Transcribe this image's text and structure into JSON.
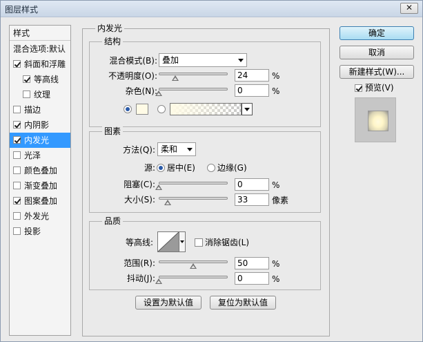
{
  "window": {
    "title": "图层样式",
    "close_glyph": "✕"
  },
  "style_list": {
    "header": "样式",
    "items": [
      {
        "label": "混合选项:默认",
        "checkbox": false,
        "indent": 0,
        "checked": false
      },
      {
        "label": "斜面和浮雕",
        "checkbox": true,
        "indent": 0,
        "checked": true
      },
      {
        "label": "等高线",
        "checkbox": true,
        "indent": 1,
        "checked": true
      },
      {
        "label": "纹理",
        "checkbox": true,
        "indent": 1,
        "checked": false
      },
      {
        "label": "描边",
        "checkbox": true,
        "indent": 0,
        "checked": false
      },
      {
        "label": "内阴影",
        "checkbox": true,
        "indent": 0,
        "checked": true
      },
      {
        "label": "内发光",
        "checkbox": true,
        "indent": 0,
        "checked": true,
        "selected": true
      },
      {
        "label": "光泽",
        "checkbox": true,
        "indent": 0,
        "checked": false
      },
      {
        "label": "颜色叠加",
        "checkbox": true,
        "indent": 0,
        "checked": false
      },
      {
        "label": "渐变叠加",
        "checkbox": true,
        "indent": 0,
        "checked": false
      },
      {
        "label": "图案叠加",
        "checkbox": true,
        "indent": 0,
        "checked": true
      },
      {
        "label": "外发光",
        "checkbox": true,
        "indent": 0,
        "checked": false
      },
      {
        "label": "投影",
        "checkbox": true,
        "indent": 0,
        "checked": false
      }
    ]
  },
  "panel": {
    "title": "内发光",
    "structure": {
      "title": "结构",
      "blend_mode_label": "混合模式(B):",
      "blend_mode_value": "叠加",
      "opacity_label": "不透明度(O):",
      "opacity_value": "24",
      "opacity_unit": "%",
      "opacity_fraction": 0.24,
      "noise_label": "杂色(N):",
      "noise_value": "0",
      "noise_unit": "%",
      "noise_fraction": 0.0,
      "color_mode": "solid",
      "glow_color": "#fffbe6"
    },
    "elements": {
      "title": "图素",
      "method_label": "方法(Q):",
      "method_value": "柔和",
      "source_label": "源:",
      "source_center": "居中(E)",
      "source_edge": "边缘(G)",
      "source_selected": "center",
      "choke_label": "阻塞(C):",
      "choke_value": "0",
      "choke_unit": "%",
      "choke_fraction": 0.0,
      "size_label": "大小(S):",
      "size_value": "33",
      "size_unit": "像素",
      "size_fraction": 0.132
    },
    "quality": {
      "title": "品质",
      "contour_label": "等高线:",
      "antialias_label": "消除锯齿(L)",
      "antialias_checked": false,
      "range_label": "范围(R):",
      "range_value": "50",
      "range_unit": "%",
      "range_fraction": 0.5,
      "jitter_label": "抖动(J):",
      "jitter_value": "0",
      "jitter_unit": "%",
      "jitter_fraction": 0.0
    },
    "make_default_label": "设置为默认值",
    "reset_default_label": "复位为默认值"
  },
  "buttons": {
    "ok": "确定",
    "cancel": "取消",
    "new_style": "新建样式(W)...",
    "preview_label": "预览(V)",
    "preview_checked": true
  }
}
